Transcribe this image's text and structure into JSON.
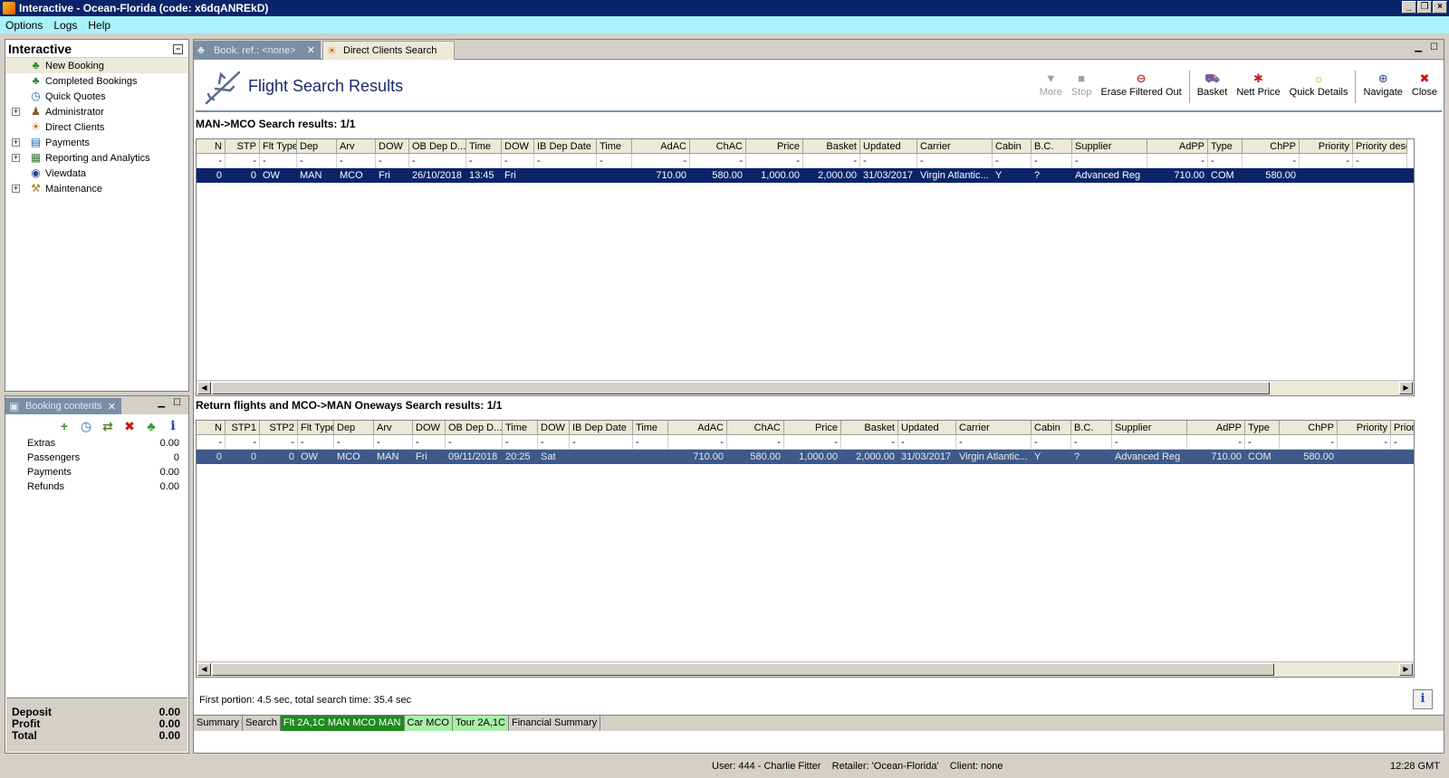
{
  "window": {
    "title": "Interactive - Ocean-Florida (code: x6dqANREkD)"
  },
  "menu": [
    "Options",
    "Logs",
    "Help"
  ],
  "nav": {
    "title": "Interactive",
    "items": [
      {
        "label": "New Booking",
        "icon": "palm-tree-icon",
        "expand": false,
        "selected": true
      },
      {
        "label": "Completed Bookings",
        "icon": "palm-tree-icon",
        "expand": false
      },
      {
        "label": "Quick Quotes",
        "icon": "clock-icon",
        "expand": false
      },
      {
        "label": "Administrator",
        "icon": "person-icon",
        "expand": true
      },
      {
        "label": "Direct Clients",
        "icon": "sun-person-icon",
        "expand": false
      },
      {
        "label": "Payments",
        "icon": "payment-icon",
        "expand": true
      },
      {
        "label": "Reporting and Analytics",
        "icon": "report-icon",
        "expand": true
      },
      {
        "label": "Viewdata",
        "icon": "globe-icon",
        "expand": false
      },
      {
        "label": "Maintenance",
        "icon": "tools-icon",
        "expand": true
      }
    ]
  },
  "booking_contents": {
    "tab_label": "Booking contents",
    "rows": [
      {
        "label": "Extras",
        "value": "0.00"
      },
      {
        "label": "Passengers",
        "value": "0"
      },
      {
        "label": "Payments",
        "value": "0.00"
      },
      {
        "label": "Refunds",
        "value": "0.00"
      }
    ],
    "totals": [
      {
        "label": "Deposit",
        "value": "0.00"
      },
      {
        "label": "Profit",
        "value": "0.00"
      },
      {
        "label": "Total",
        "value": "0.00"
      }
    ]
  },
  "tabs": {
    "active": "Book. ref.: <none>",
    "other": "Direct Clients Search"
  },
  "header": {
    "title": "Flight Search Results",
    "toolbar": [
      {
        "label": "More",
        "icon": "triangle-down-icon",
        "dim": true
      },
      {
        "label": "Stop",
        "icon": "stop-icon",
        "dim": true
      },
      {
        "label": "Erase Filtered Out",
        "icon": "erase-icon",
        "dim": false
      },
      {
        "sep": true
      },
      {
        "label": "Basket",
        "icon": "basket-icon",
        "dim": false
      },
      {
        "label": "Nett Price",
        "icon": "nett-price-icon",
        "dim": false
      },
      {
        "label": "Quick Details",
        "icon": "lightbulb-icon",
        "dim": false
      },
      {
        "sep": true
      },
      {
        "label": "Navigate",
        "icon": "navigate-icon",
        "dim": false
      },
      {
        "label": "Close",
        "icon": "close-icon",
        "dim": false
      }
    ]
  },
  "outbound": {
    "title": "MAN->MCO Search results: 1/1",
    "columns": [
      "N",
      "STP",
      "Flt Type",
      "Dep",
      "Arv",
      "DOW",
      "OB Dep D...",
      "Time",
      "DOW",
      "IB Dep Date",
      "Time",
      "AdAC",
      "ChAC",
      "Price",
      "Basket",
      "Updated",
      "Carrier",
      "Cabin",
      "B.C.",
      "Supplier",
      "AdPP",
      "Type",
      "ChPP",
      "Priority",
      "Priority desc"
    ],
    "filter": [
      "-",
      "-",
      "-",
      "-",
      "-",
      "-",
      "-",
      "-",
      "-",
      "-",
      "-",
      "-",
      "-",
      "-",
      "-",
      "-",
      "-",
      "-",
      "-",
      "-",
      "-",
      "-",
      "-",
      "-",
      "-"
    ],
    "rows": [
      [
        "0",
        "0",
        "OW",
        "MAN",
        "MCO",
        "Fri",
        "26/10/2018",
        "13:45",
        "Fri",
        "",
        "",
        "710.00",
        "580.00",
        "1,000.00",
        "2,000.00",
        "31/03/2017",
        "Virgin Atlantic...",
        "Y",
        "?",
        "Advanced Reg",
        "710.00",
        "COM",
        "580.00",
        "",
        ""
      ]
    ]
  },
  "return": {
    "title": "Return flights and MCO->MAN Oneways Search results: 1/1",
    "columns": [
      "N",
      "STP1",
      "STP2",
      "Flt Type",
      "Dep",
      "Arv",
      "DOW",
      "OB Dep D...",
      "Time",
      "DOW",
      "IB Dep Date",
      "Time",
      "AdAC",
      "ChAC",
      "Price",
      "Basket",
      "Updated",
      "Carrier",
      "Cabin",
      "B.C.",
      "Supplier",
      "AdPP",
      "Type",
      "ChPP",
      "Priority",
      "Prior"
    ],
    "filter": [
      "-",
      "-",
      "-",
      "-",
      "-",
      "-",
      "-",
      "-",
      "-",
      "-",
      "-",
      "-",
      "-",
      "-",
      "-",
      "-",
      "-",
      "-",
      "-",
      "-",
      "-",
      "-",
      "-",
      "-",
      "-",
      "-"
    ],
    "rows": [
      [
        "0",
        "0",
        "0",
        "OW",
        "MCO",
        "MAN",
        "Fri",
        "09/11/2018",
        "20:25",
        "Sat",
        "",
        "",
        "710.00",
        "580.00",
        "1,000.00",
        "2,000.00",
        "31/03/2017",
        "Virgin Atlantic...",
        "Y",
        "?",
        "Advanced Reg",
        "710.00",
        "COM",
        "580.00",
        "",
        ""
      ]
    ]
  },
  "status_message": "First portion: 4.5 sec, total search time: 35.4 sec",
  "bottom_tabs": [
    {
      "label": "Summary",
      "style": ""
    },
    {
      "label": "Search",
      "style": ""
    },
    {
      "label": "Flt 2A,1C MAN MCO MAN",
      "style": "green"
    },
    {
      "label": "Car MCO",
      "style": "lightgreen"
    },
    {
      "label": "Tour 2A,1C",
      "style": "lightgreen"
    },
    {
      "label": "Financial Summary",
      "style": ""
    }
  ],
  "statusbar": {
    "user": "User: 444 - Charlie Fitter    Retailer: 'Ocean-Florida'    Client: none",
    "time": "12:28 GMT"
  },
  "colors": {
    "title_bar": "#0a246a",
    "menu_bar": "#a9f2fb",
    "selected_row": "#0a246a",
    "green_tab": "#1f8a1f"
  }
}
